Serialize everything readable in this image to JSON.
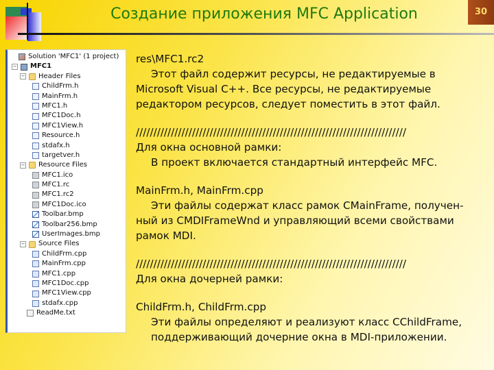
{
  "slide": {
    "title": "Создание приложения MFC Application",
    "page_number": "30"
  },
  "tree": {
    "solution": "Solution 'MFC1' (1 project)",
    "project": "MFC1",
    "header_folder": "Header Files",
    "header_files": [
      "ChildFrm.h",
      "MainFrm.h",
      "MFC1.h",
      "MFC1Doc.h",
      "MFC1View.h",
      "Resource.h",
      "stdafx.h",
      "targetver.h"
    ],
    "resource_folder": "Resource Files",
    "resource_files": [
      {
        "name": "MFC1.ico",
        "icon": "icon-file-icon"
      },
      {
        "name": "MFC1.rc",
        "icon": "resource-file-icon"
      },
      {
        "name": "MFC1.rc2",
        "icon": "resource-file-icon"
      },
      {
        "name": "MFC1Doc.ico",
        "icon": "icon-file-icon"
      },
      {
        "name": "Toolbar.bmp",
        "icon": "bitmap-file-icon"
      },
      {
        "name": "Toolbar256.bmp",
        "icon": "bitmap-file-icon"
      },
      {
        "name": "UserImages.bmp",
        "icon": "bitmap-file-icon"
      }
    ],
    "source_folder": "Source Files",
    "source_files": [
      "ChildFrm.cpp",
      "MainFrm.cpp",
      "MFC1.cpp",
      "MFC1Doc.cpp",
      "MFC1View.cpp",
      "stdafx.cpp"
    ],
    "readme": "ReadMe.txt"
  },
  "content": {
    "l1": "res\\MFC1.rc2",
    "l2": "Этот файл содержит ресурсы, не редактируемые в",
    "l3": "Microsoft Visual C++. Все ресурсы, не редактируемые",
    "l4": "редактором ресурсов, следует поместить в этот файл.",
    "sep1": "/////////////////////////////////////////////////////////////////////////////",
    "l5": "Для окна основной рамки:",
    "l6": "В проект включается стандартный интерфейс MFC.",
    "l7": "MainFrm.h, MainFrm.cpp",
    "l8": "Эти файлы содержат класс рамок CMainFrame, получен-",
    "l9": "ный из CMDIFrameWnd и управляющий всеми свойствами",
    "l10": "рамок MDI.",
    "sep2": "/////////////////////////////////////////////////////////////////////////////",
    "l11": "Для окна дочерней рамки:",
    "l12": "ChildFrm.h, ChildFrm.cpp",
    "l13": "Эти файлы определяют и реализуют класс CChildFrame,",
    "l14": "поддерживающий дочерние окна в MDI-приложении."
  }
}
